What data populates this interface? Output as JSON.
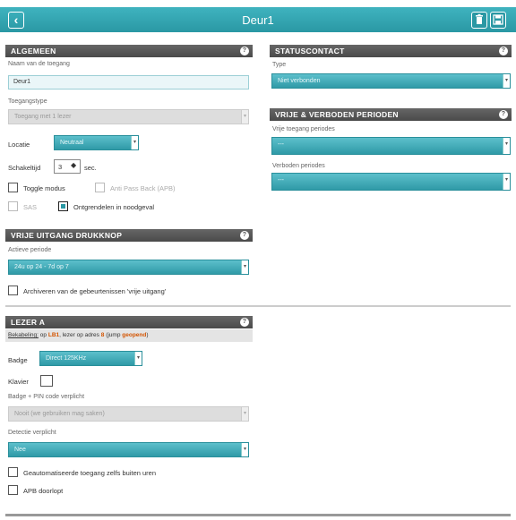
{
  "header": {
    "title": "Deur1",
    "back_icon": "chevron-left-icon",
    "delete_icon": "trash-icon",
    "save_icon": "save-icon"
  },
  "algemeen": {
    "title": "Algemeen",
    "name_label": "Naam van de toegang",
    "name_value": "Deur1",
    "type_label": "Toegangstype",
    "type_value": "Toegang met 1 lezer",
    "location_label": "Locatie",
    "location_value": "Neutraal",
    "unlock_label": "Schakeltijd",
    "unlock_value": "3",
    "unlock_unit": "sec.",
    "toggle_label": "Toggle modus",
    "antipassback_label": "Anti Pass Back (APB)",
    "sas_label": "SAS",
    "emergency_label": "Ontgrendelen in noodgeval",
    "emergency_checked": true
  },
  "vrije_uitgang": {
    "title": "Vrije uitgang drukknop",
    "period_label": "Actieve periode",
    "period_value": "24u op 24 - 7d op 7",
    "archive_label": "Archiveren van de gebeurtenissen 'vrije uitgang'"
  },
  "lezer": {
    "title": "Lezer A",
    "info_prefix": "Bekabeling:",
    "info_text_1": "op",
    "info_bus": "LB1",
    "info_text_2": ", lezer op adres",
    "info_address": "8",
    "info_text_3": "(jump",
    "info_jump": "geopend",
    "info_text_4": ")",
    "badge_label": "Badge",
    "badge_value": "Direct 125KHz",
    "keypad_label": "Klavier",
    "pin_label": "Badge + PIN code verplicht",
    "pin_value": "Nooit (we gebruiken mag saken)",
    "detect_label": "Detectie verplicht",
    "detect_value": "Nee",
    "auto_label": "Geautomatiseerde toegang zelfs buiten uren",
    "apb_label": "APB doorlopt"
  },
  "statuscontact": {
    "title": "Statuscontact",
    "type_label": "Type",
    "type_value": "Niet verbonden"
  },
  "perioden": {
    "title": "Vrije & verboden perioden",
    "free_label": "Vrije toegang periodes",
    "free_value": "---",
    "forbidden_label": "Verboden periodes",
    "forbidden_value": "---"
  },
  "help_glyph": "?",
  "arrow_glyph": "▾",
  "accent_color": "#2a98a4",
  "highlight_color": "#d35400"
}
